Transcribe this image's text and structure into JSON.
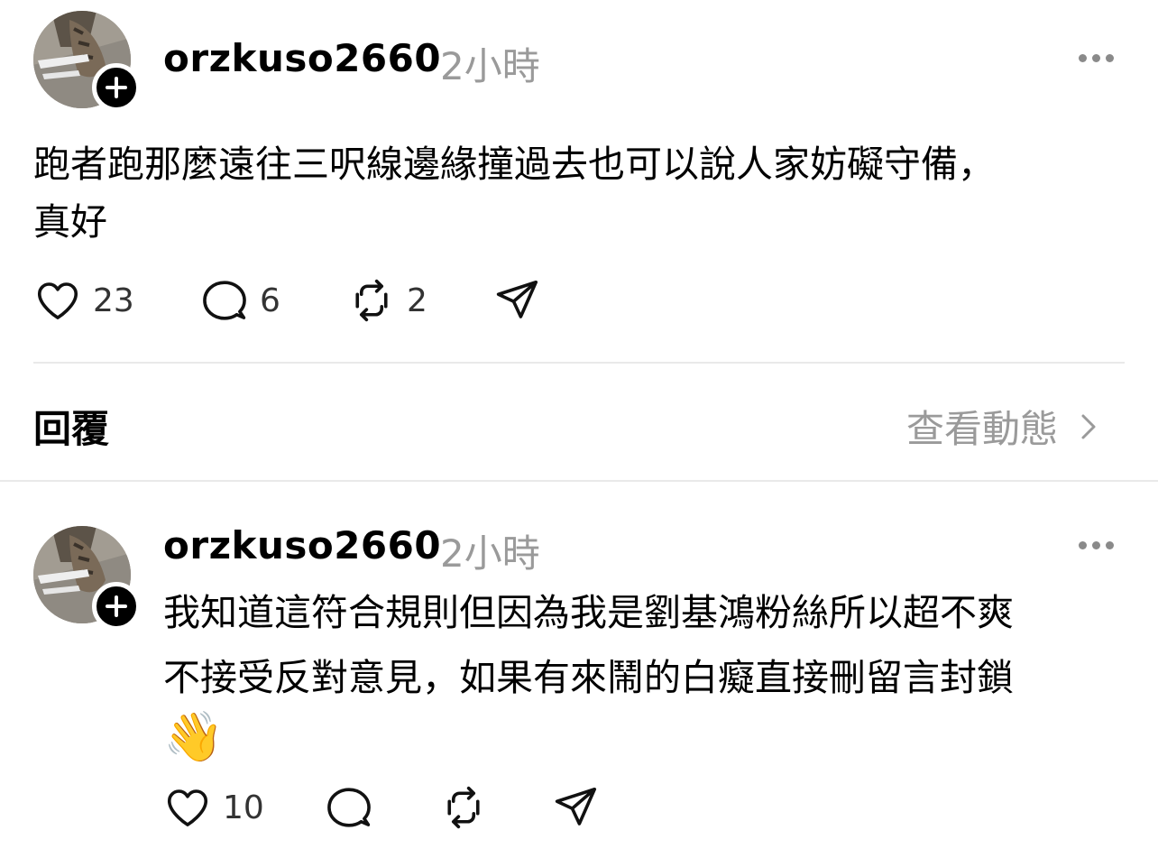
{
  "post": {
    "username": "orzkuso2660",
    "time": "2小時",
    "content_line1": "跑者跑那麼遠往三呎線邊緣撞過去也可以說人家妨礙守備，",
    "content_line2": "真好",
    "likes": "23",
    "comments": "6",
    "reposts": "2"
  },
  "replies_header": {
    "label": "回覆",
    "activity_label": "查看動態"
  },
  "reply": {
    "username": "orzkuso2660",
    "time": "2小時",
    "content_line1": "我知道這符合規則但因為我是劉基鴻粉絲所以超不爽",
    "content_line2": "不接受反對意見，如果有來鬧的白癡直接刪留言封鎖",
    "emoji": "👋",
    "likes": "10"
  },
  "icons": {
    "like": "heart-icon",
    "comment": "comment-icon",
    "repost": "repost-icon",
    "share": "send-icon",
    "more": "more-icon",
    "follow": "plus-icon",
    "chevron": "chevron-right-icon"
  }
}
